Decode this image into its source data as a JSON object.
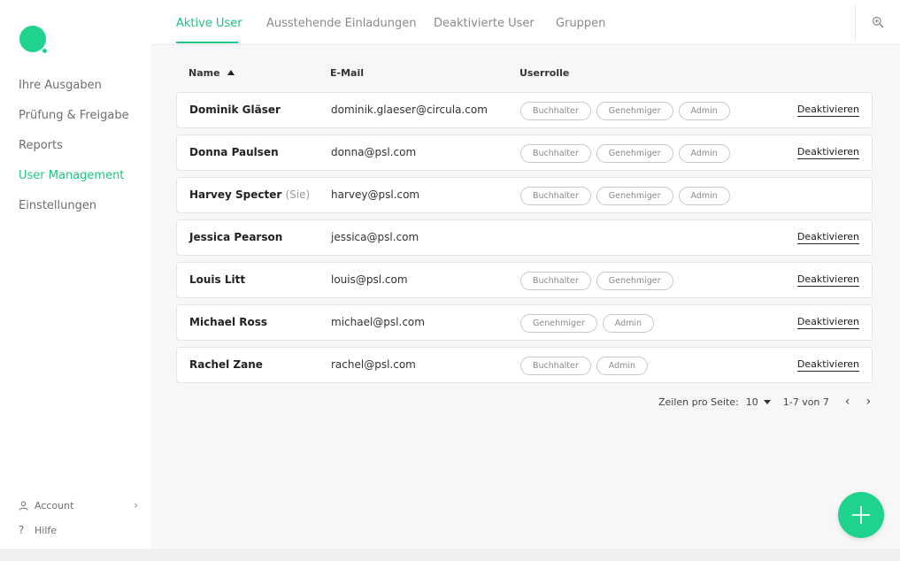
{
  "colors": {
    "accent": "#1fc47f",
    "fab": "#1fd28e"
  },
  "sidebar": {
    "items": [
      {
        "label": "Ihre Ausgaben"
      },
      {
        "label": "Prüfung & Freigabe"
      },
      {
        "label": "Reports"
      },
      {
        "label": "User Management",
        "active": true
      },
      {
        "label": "Einstellungen"
      }
    ],
    "account_label": "Account",
    "help_label": "Hilfe",
    "account_icon": "user-icon",
    "help_icon": "question-icon"
  },
  "tabs": [
    {
      "label": "Aktive User",
      "active": true
    },
    {
      "label": "Ausstehende Einladungen"
    },
    {
      "label": "Deaktivierte User"
    },
    {
      "label": "Gruppen"
    }
  ],
  "table": {
    "columns": {
      "name": "Name",
      "email": "E-Mail",
      "role": "Userrolle"
    },
    "deactivate_label": "Deaktivieren",
    "rows": [
      {
        "name": "Dominik Gläser",
        "suffix": "",
        "email": "dominik.glaeser@circula.com",
        "roles": [
          "Buchhalter",
          "Genehmiger",
          "Admin"
        ],
        "deactivatable": true
      },
      {
        "name": "Donna Paulsen",
        "suffix": "",
        "email": "donna@psl.com",
        "roles": [
          "Buchhalter",
          "Genehmiger",
          "Admin"
        ],
        "deactivatable": true
      },
      {
        "name": "Harvey Specter",
        "suffix": "(Sie)",
        "email": "harvey@psl.com",
        "roles": [
          "Buchhalter",
          "Genehmiger",
          "Admin"
        ],
        "deactivatable": false
      },
      {
        "name": "Jessica Pearson",
        "suffix": "",
        "email": "jessica@psl.com",
        "roles": [],
        "deactivatable": true
      },
      {
        "name": "Louis Litt",
        "suffix": "",
        "email": "louis@psl.com",
        "roles": [
          "Buchhalter",
          "Genehmiger"
        ],
        "deactivatable": true
      },
      {
        "name": "Michael Ross",
        "suffix": "",
        "email": "michael@psl.com",
        "roles": [
          "Genehmiger",
          "Admin"
        ],
        "deactivatable": true
      },
      {
        "name": "Rachel Zane",
        "suffix": "",
        "email": "rachel@psl.com",
        "roles": [
          "Buchhalter",
          "Admin"
        ],
        "deactivatable": true
      }
    ]
  },
  "pagination": {
    "rows_per_page_label": "Zeilen pro Seite:",
    "rows_per_page_value": "10",
    "range_label": "1-7 von 7",
    "prev_symbol": "‹",
    "next_symbol": "›"
  },
  "icons": {
    "zoom": "zoom-in-icon",
    "fab": "plus-icon"
  }
}
